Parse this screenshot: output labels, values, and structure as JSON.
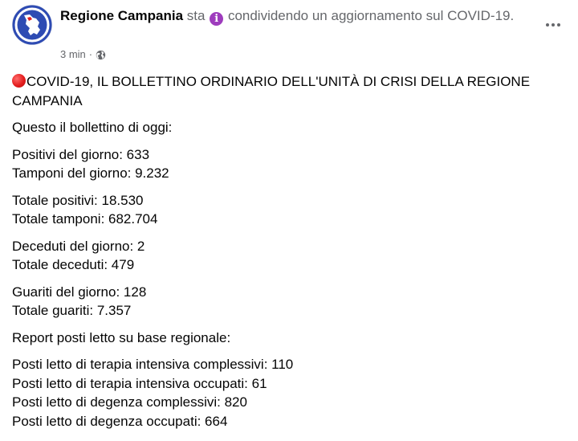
{
  "post": {
    "author": "Regione Campania",
    "action_prefix": "sta",
    "action_icon": "info-icon",
    "action_text": "condividendo un aggiornamento sul COVID-19.",
    "timestamp": "3 min",
    "separator": "·",
    "audience_icon": "globe-icon",
    "more_icon": "more-options-icon"
  },
  "content": {
    "title_icon": "red-circle-icon",
    "title": "COVID-19, IL BOLLETTINO ORDINARIO DELL'UNITÀ DI CRISI DELLA REGIONE CAMPANIA",
    "intro": "Questo il bollettino di oggi:",
    "paragraphs": [
      [
        "Positivi del giorno: 633",
        "Tamponi del giorno: 9.232"
      ],
      [
        "Totale positivi: 18.530",
        "Totale tamponi: 682.704"
      ],
      [
        "Deceduti del giorno: 2",
        "Totale deceduti: 479"
      ],
      [
        "Guariti del giorno: 128",
        "Totale guariti: 7.357"
      ]
    ],
    "report_heading": "Report posti letto su base regionale:",
    "beds": [
      "Posti letto di terapia intensiva complessivi: 110",
      "Posti letto di terapia intensiva occupati: 61",
      "Posti letto di degenza complessivi: 820",
      "Posti letto di degenza occupati: 664"
    ]
  },
  "colors": {
    "secondary_text": "#65676b",
    "primary_text": "#050505",
    "info_icon": "#9e3cbd",
    "red_circle": "#e41e1e",
    "avatar_blue": "#2e4bb3"
  }
}
